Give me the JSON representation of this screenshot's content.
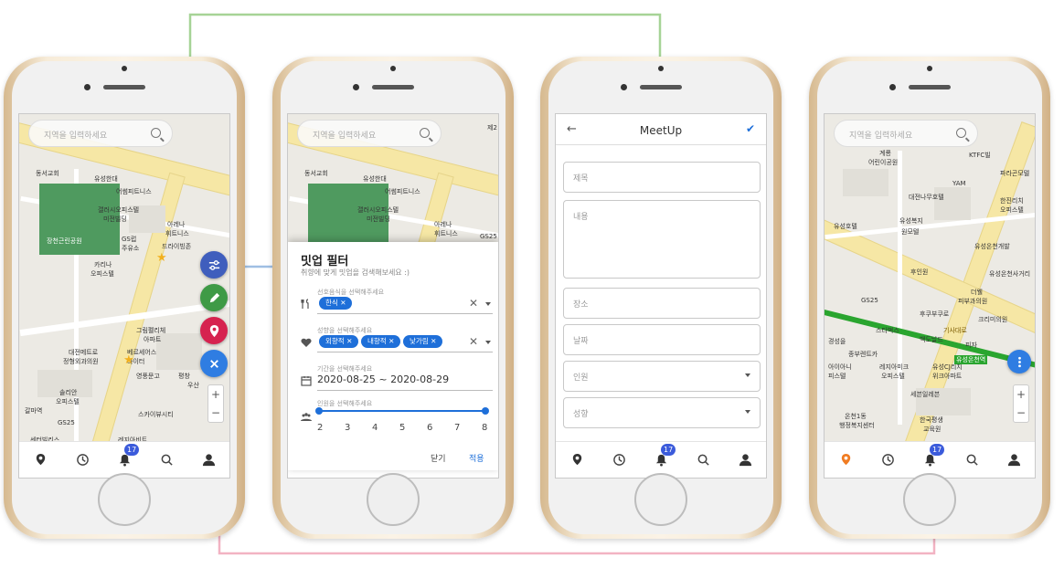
{
  "colors": {
    "connector_green": "#a6d396",
    "connector_blue": "#9fbfe3",
    "connector_pink": "#f2b3c3",
    "primary": "#1e6fd9",
    "badge": "#3b5bdb",
    "fab_filter": "#3f5ebd",
    "fab_write": "#3e9a46",
    "fab_pin": "#d6234f",
    "fab_close": "#2f7de2",
    "nav_active": "#f07c22"
  },
  "phone1": {
    "search_placeholder": "지역을 입력하세요",
    "map_labels": [
      "동서교회",
      "유성한대",
      "어썸피트니스",
      "갤러시오피스텔",
      "미전빌딩",
      "아레나",
      "휘트니스",
      "GS럽",
      "주유소",
      "장천근린공원",
      "드라이빙존",
      "카리나",
      "오피스텔",
      "그림펠리체",
      "아파트",
      "대전메트로",
      "정형외과의원",
      "베르세어스",
      "바이터",
      "영풍문고",
      "평창",
      "우산",
      "스카이뷰시티",
      "솔리안",
      "오피스텔",
      "레지아비트",
      "GS25",
      "센터빌리스",
      "갈마역"
    ],
    "nav_badge": "17",
    "zoom": {
      "plus": "+",
      "minus": "−"
    }
  },
  "phone2": {
    "search_placeholder": "지역을 입력하세요",
    "map_labels": [
      "동서교회",
      "유성한대",
      "어썸피트니스",
      "갤러시오피스텔",
      "미전빌딩",
      "아레나",
      "휘트니스",
      "GS25",
      "제2"
    ],
    "filter": {
      "title": "밋업 필터",
      "subtitle": "취향에 맞게 밋업을 검색해보세요 :)",
      "food_caption": "선호음식을 선택해주세요",
      "food_chips": [
        "한식"
      ],
      "personality_caption": "성향을 선택해주세요",
      "personality_chips": [
        "외향적",
        "내향적",
        "낯가림"
      ],
      "period_caption": "기간을 선택해주세요",
      "period_value": "2020-08-25 ~ 2020-08-29",
      "people_caption": "인원을 선택해주세요",
      "people_ticks": [
        "2",
        "3",
        "4",
        "5",
        "6",
        "7",
        "8"
      ],
      "people_range": [
        2,
        8
      ],
      "close_label": "닫기",
      "apply_label": "적용"
    }
  },
  "phone3": {
    "back": "←",
    "title": "MeetUp",
    "confirm": "✔",
    "fields": {
      "title": "제목",
      "content": "내용",
      "place": "장소",
      "date": "날짜",
      "people": "인원",
      "personality": "성향"
    },
    "nav_badge": "17"
  },
  "phone4": {
    "search_placeholder": "지역을 입력하세요",
    "map_labels": [
      "계룡",
      "어린이공원",
      "KTFC빌",
      "YAM",
      "파라곤모텔",
      "대전나무호텔",
      "한진리치",
      "오피스텔",
      "유성복지",
      "원모텔",
      "유성호텔",
      "유성온천개발",
      "후인원",
      "유성온천사거리",
      "GS25",
      "더웰",
      "피부과의원",
      "후쿠부쿠로",
      "크리미의원",
      "스타벅스",
      "백도날드",
      "피자",
      "경성을",
      "종부렌트카",
      "레지아미크",
      "오피스텔",
      "유성CJ리치",
      "위크아파트",
      "아이아니",
      "피스텔",
      "세븐일레븐",
      "유성온천역",
      "온천1동",
      "행정복지센터",
      "한국평생",
      "교육원",
      "기사대로"
    ],
    "nav_badge": "17",
    "zoom": {
      "plus": "+",
      "minus": "−"
    }
  }
}
